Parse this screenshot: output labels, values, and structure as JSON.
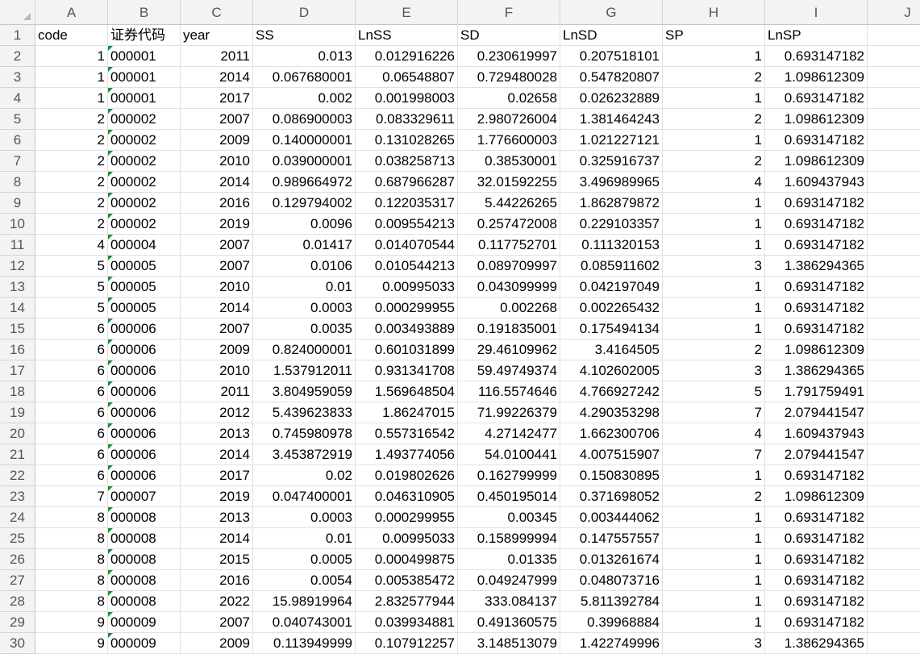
{
  "columns": [
    "A",
    "B",
    "C",
    "D",
    "E",
    "F",
    "G",
    "H",
    "I",
    "J"
  ],
  "header_row": {
    "num": "1",
    "cells": [
      "code",
      "证券代码",
      "year",
      "SS",
      "LnSS",
      "SD",
      "LnSD",
      "SP",
      "LnSP",
      ""
    ]
  },
  "rows": [
    {
      "num": "2",
      "cells": [
        "1",
        "000001",
        "2011",
        "0.013",
        "0.012916226",
        "0.230619997",
        "0.207518101",
        "1",
        "0.693147182",
        ""
      ]
    },
    {
      "num": "3",
      "cells": [
        "1",
        "000001",
        "2014",
        "0.067680001",
        "0.06548807",
        "0.729480028",
        "0.547820807",
        "2",
        "1.098612309",
        ""
      ]
    },
    {
      "num": "4",
      "cells": [
        "1",
        "000001",
        "2017",
        "0.002",
        "0.001998003",
        "0.02658",
        "0.026232889",
        "1",
        "0.693147182",
        ""
      ]
    },
    {
      "num": "5",
      "cells": [
        "2",
        "000002",
        "2007",
        "0.086900003",
        "0.083329611",
        "2.980726004",
        "1.381464243",
        "2",
        "1.098612309",
        ""
      ]
    },
    {
      "num": "6",
      "cells": [
        "2",
        "000002",
        "2009",
        "0.140000001",
        "0.131028265",
        "1.776600003",
        "1.021227121",
        "1",
        "0.693147182",
        ""
      ]
    },
    {
      "num": "7",
      "cells": [
        "2",
        "000002",
        "2010",
        "0.039000001",
        "0.038258713",
        "0.38530001",
        "0.325916737",
        "2",
        "1.098612309",
        ""
      ]
    },
    {
      "num": "8",
      "cells": [
        "2",
        "000002",
        "2014",
        "0.989664972",
        "0.687966287",
        "32.01592255",
        "3.496989965",
        "4",
        "1.609437943",
        ""
      ]
    },
    {
      "num": "9",
      "cells": [
        "2",
        "000002",
        "2016",
        "0.129794002",
        "0.122035317",
        "5.44226265",
        "1.862879872",
        "1",
        "0.693147182",
        ""
      ]
    },
    {
      "num": "10",
      "cells": [
        "2",
        "000002",
        "2019",
        "0.0096",
        "0.009554213",
        "0.257472008",
        "0.229103357",
        "1",
        "0.693147182",
        ""
      ]
    },
    {
      "num": "11",
      "cells": [
        "4",
        "000004",
        "2007",
        "0.01417",
        "0.014070544",
        "0.117752701",
        "0.111320153",
        "1",
        "0.693147182",
        ""
      ]
    },
    {
      "num": "12",
      "cells": [
        "5",
        "000005",
        "2007",
        "0.0106",
        "0.010544213",
        "0.089709997",
        "0.085911602",
        "3",
        "1.386294365",
        ""
      ]
    },
    {
      "num": "13",
      "cells": [
        "5",
        "000005",
        "2010",
        "0.01",
        "0.00995033",
        "0.043099999",
        "0.042197049",
        "1",
        "0.693147182",
        ""
      ]
    },
    {
      "num": "14",
      "cells": [
        "5",
        "000005",
        "2014",
        "0.0003",
        "0.000299955",
        "0.002268",
        "0.002265432",
        "1",
        "0.693147182",
        ""
      ]
    },
    {
      "num": "15",
      "cells": [
        "6",
        "000006",
        "2007",
        "0.0035",
        "0.003493889",
        "0.191835001",
        "0.175494134",
        "1",
        "0.693147182",
        ""
      ]
    },
    {
      "num": "16",
      "cells": [
        "6",
        "000006",
        "2009",
        "0.824000001",
        "0.601031899",
        "29.46109962",
        "3.4164505",
        "2",
        "1.098612309",
        ""
      ]
    },
    {
      "num": "17",
      "cells": [
        "6",
        "000006",
        "2010",
        "1.537912011",
        "0.931341708",
        "59.49749374",
        "4.102602005",
        "3",
        "1.386294365",
        ""
      ]
    },
    {
      "num": "18",
      "cells": [
        "6",
        "000006",
        "2011",
        "3.804959059",
        "1.569648504",
        "116.5574646",
        "4.766927242",
        "5",
        "1.791759491",
        ""
      ]
    },
    {
      "num": "19",
      "cells": [
        "6",
        "000006",
        "2012",
        "5.439623833",
        "1.86247015",
        "71.99226379",
        "4.290353298",
        "7",
        "2.079441547",
        ""
      ]
    },
    {
      "num": "20",
      "cells": [
        "6",
        "000006",
        "2013",
        "0.745980978",
        "0.557316542",
        "4.27142477",
        "1.662300706",
        "4",
        "1.609437943",
        ""
      ]
    },
    {
      "num": "21",
      "cells": [
        "6",
        "000006",
        "2014",
        "3.453872919",
        "1.493774056",
        "54.0100441",
        "4.007515907",
        "7",
        "2.079441547",
        ""
      ]
    },
    {
      "num": "22",
      "cells": [
        "6",
        "000006",
        "2017",
        "0.02",
        "0.019802626",
        "0.162799999",
        "0.150830895",
        "1",
        "0.693147182",
        ""
      ]
    },
    {
      "num": "23",
      "cells": [
        "7",
        "000007",
        "2019",
        "0.047400001",
        "0.046310905",
        "0.450195014",
        "0.371698052",
        "2",
        "1.098612309",
        ""
      ]
    },
    {
      "num": "24",
      "cells": [
        "8",
        "000008",
        "2013",
        "0.0003",
        "0.000299955",
        "0.00345",
        "0.003444062",
        "1",
        "0.693147182",
        ""
      ]
    },
    {
      "num": "25",
      "cells": [
        "8",
        "000008",
        "2014",
        "0.01",
        "0.00995033",
        "0.158999994",
        "0.147557557",
        "1",
        "0.693147182",
        ""
      ]
    },
    {
      "num": "26",
      "cells": [
        "8",
        "000008",
        "2015",
        "0.0005",
        "0.000499875",
        "0.01335",
        "0.013261674",
        "1",
        "0.693147182",
        ""
      ]
    },
    {
      "num": "27",
      "cells": [
        "8",
        "000008",
        "2016",
        "0.0054",
        "0.005385472",
        "0.049247999",
        "0.048073716",
        "1",
        "0.693147182",
        ""
      ]
    },
    {
      "num": "28",
      "cells": [
        "8",
        "000008",
        "2022",
        "15.98919964",
        "2.832577944",
        "333.084137",
        "5.811392784",
        "1",
        "0.693147182",
        ""
      ]
    },
    {
      "num": "29",
      "cells": [
        "9",
        "000009",
        "2007",
        "0.040743001",
        "0.039934881",
        "0.491360575",
        "0.39968884",
        "1",
        "0.693147182",
        ""
      ]
    },
    {
      "num": "30",
      "cells": [
        "9",
        "000009",
        "2009",
        "0.113949999",
        "0.107912257",
        "3.148513079",
        "1.422749996",
        "3",
        "1.386294365",
        ""
      ]
    }
  ]
}
